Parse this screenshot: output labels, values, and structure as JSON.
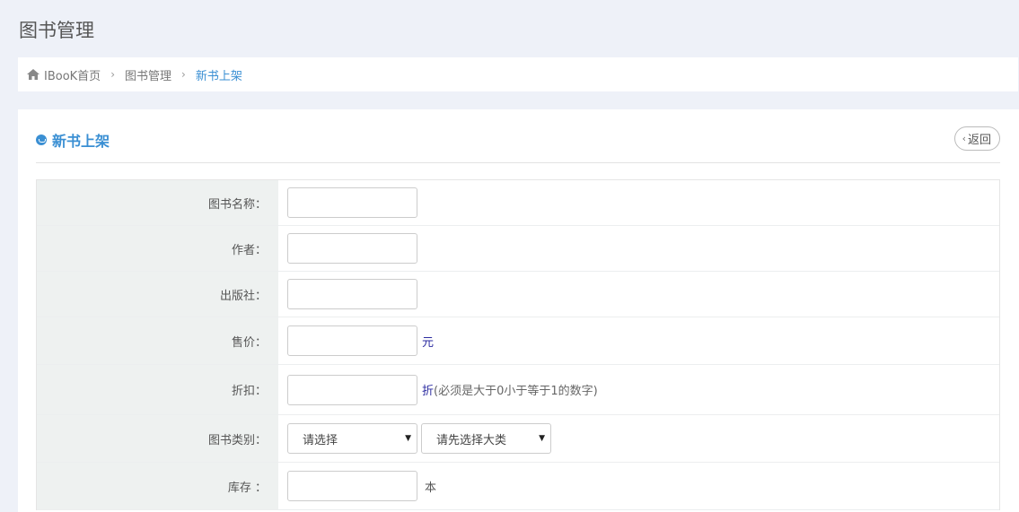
{
  "page_title": "图书管理",
  "breadcrumb": {
    "home": "IBooK首页",
    "section": "图书管理",
    "current": "新书上架",
    "separator": "›"
  },
  "panel": {
    "title": "新书上架",
    "back_label": "返回",
    "back_chevron": "‹"
  },
  "form": {
    "book_name_label": "图书名称：",
    "author_label": "作者：",
    "publisher_label": "出版社：",
    "price_label": "售价：",
    "price_unit": "元",
    "discount_label": "折扣：",
    "discount_unit": "折",
    "discount_hint": "(必须是大于0小于等于1的数字)",
    "category_label": "图书类别：",
    "category_main": "请选择",
    "category_sub": "请先选择大类",
    "stock_label": "库存 ：",
    "stock_unit": "本",
    "book_name_value": "",
    "author_value": "",
    "publisher_value": "",
    "price_value": "",
    "discount_value": "",
    "stock_value": ""
  },
  "colors": {
    "accent": "#3a8fd3",
    "label_bg": "#eef1f0",
    "page_bg": "#eef1f8"
  }
}
